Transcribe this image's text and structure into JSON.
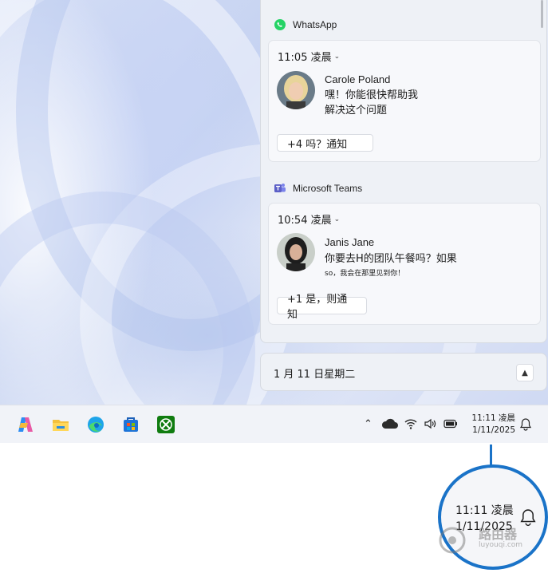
{
  "notifications": [
    {
      "app": "WhatsApp",
      "time": "11:05 凌晨",
      "sender": "Carole Poland",
      "message_line1": "嘿！你能很快帮助我",
      "message_line2": "解决这个问题",
      "action": "+4 吗？通知"
    },
    {
      "app": "Microsoft Teams",
      "time": "10:54 凌晨",
      "sender": "Janis Jane",
      "message_line1": "你要去H的团队午餐吗？如果",
      "message_line2": "so，我会在那里见到你！",
      "action": "+1 是，则通知"
    }
  ],
  "calendar": {
    "date": "1 月 11 日星期二"
  },
  "taskbar": {
    "time": "11:11 凌晨",
    "date": "1/11/2025"
  },
  "zoom": {
    "time": "11:11 凌晨",
    "date": "1/11/2025"
  },
  "watermark": {
    "title": "路由器",
    "sub": "luyouqi.com"
  },
  "colors": {
    "accent": "#1a73c8",
    "whatsapp": "#25d366",
    "teams": "#5b5fc7",
    "xbox": "#107c10"
  },
  "icons": {
    "taskbar": [
      "copilot-icon",
      "file-explorer-icon",
      "edge-icon",
      "store-icon",
      "xbox-icon"
    ],
    "tray": [
      "chevron-up-icon",
      "cloud-icon",
      "wifi-icon",
      "volume-icon",
      "battery-icon",
      "bell-icon"
    ]
  }
}
